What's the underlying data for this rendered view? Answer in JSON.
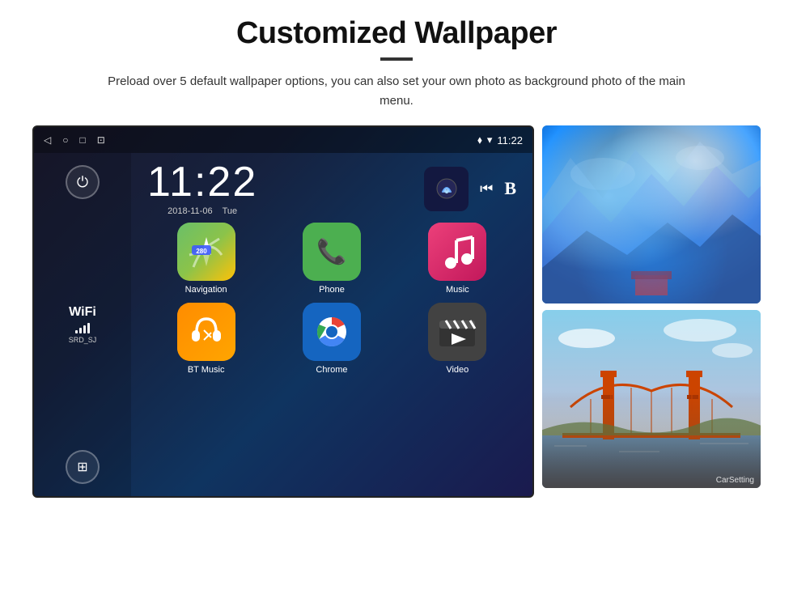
{
  "page": {
    "title": "Customized Wallpaper",
    "description": "Preload over 5 default wallpaper options, you can also set your own photo as background photo of the main menu."
  },
  "android": {
    "time": "11:22",
    "date": "2018-11-06",
    "day": "Tue",
    "wifi_name": "SRD_SJ",
    "wifi_label": "WiFi",
    "status_time": "11:22",
    "apps": [
      {
        "name": "Navigation",
        "icon": "nav",
        "label": "Navigation"
      },
      {
        "name": "Phone",
        "icon": "phone",
        "label": "Phone"
      },
      {
        "name": "Music",
        "icon": "music",
        "label": "Music"
      },
      {
        "name": "BT Music",
        "icon": "bt",
        "label": "BT Music"
      },
      {
        "name": "Chrome",
        "icon": "chrome",
        "label": "Chrome"
      },
      {
        "name": "Video",
        "icon": "video",
        "label": "Video"
      }
    ],
    "car_setting": "CarSetting"
  },
  "icons": {
    "back": "◁",
    "home": "○",
    "recents": "□",
    "screenshot": "⊡",
    "location": "⬧",
    "wifi": "▾",
    "power": "⏻",
    "apps": "⊞"
  }
}
